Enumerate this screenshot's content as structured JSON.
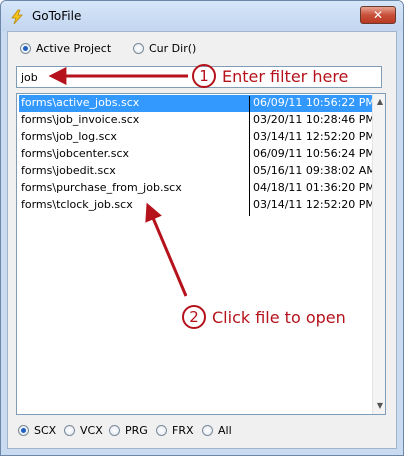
{
  "window": {
    "title": "GoToFile",
    "close_glyph": "✕"
  },
  "scope": {
    "options": [
      {
        "label": "Active Project",
        "checked": true
      },
      {
        "label": "Cur Dir()",
        "checked": false
      }
    ]
  },
  "filter": {
    "value": "job"
  },
  "files": [
    {
      "name": "forms\\active_jobs.scx",
      "date": "06/09/11 10:56:22 PM",
      "selected": true
    },
    {
      "name": "forms\\job_invoice.scx",
      "date": "03/20/11 10:28:46 PM",
      "selected": false
    },
    {
      "name": "forms\\job_log.scx",
      "date": "03/14/11 12:52:20 PM",
      "selected": false
    },
    {
      "name": "forms\\jobcenter.scx",
      "date": "06/09/11 10:56:24 PM",
      "selected": false
    },
    {
      "name": "forms\\jobedit.scx",
      "date": "05/16/11 09:38:02 AM",
      "selected": false
    },
    {
      "name": "forms\\purchase_from_job.scx",
      "date": "04/18/11 01:36:20 PM",
      "selected": false
    },
    {
      "name": "forms\\tclock_job.scx",
      "date": "03/14/11 12:52:20 PM",
      "selected": false
    }
  ],
  "file_types": [
    {
      "label": "SCX",
      "checked": true
    },
    {
      "label": "VCX",
      "checked": false
    },
    {
      "label": "PRG",
      "checked": false
    },
    {
      "label": "FRX",
      "checked": false
    },
    {
      "label": "All",
      "checked": false
    }
  ],
  "annotations": [
    {
      "number": "1",
      "text": "Enter filter here"
    },
    {
      "number": "2",
      "text": "Click file to open"
    }
  ],
  "colors": {
    "selection": "#3399ff",
    "annotation": "#b5121b"
  },
  "icons": {
    "app": "lightning-icon",
    "close": "close-icon",
    "scroll_up": "scroll-up-arrow-icon",
    "scroll_down": "scroll-down-arrow-icon"
  }
}
